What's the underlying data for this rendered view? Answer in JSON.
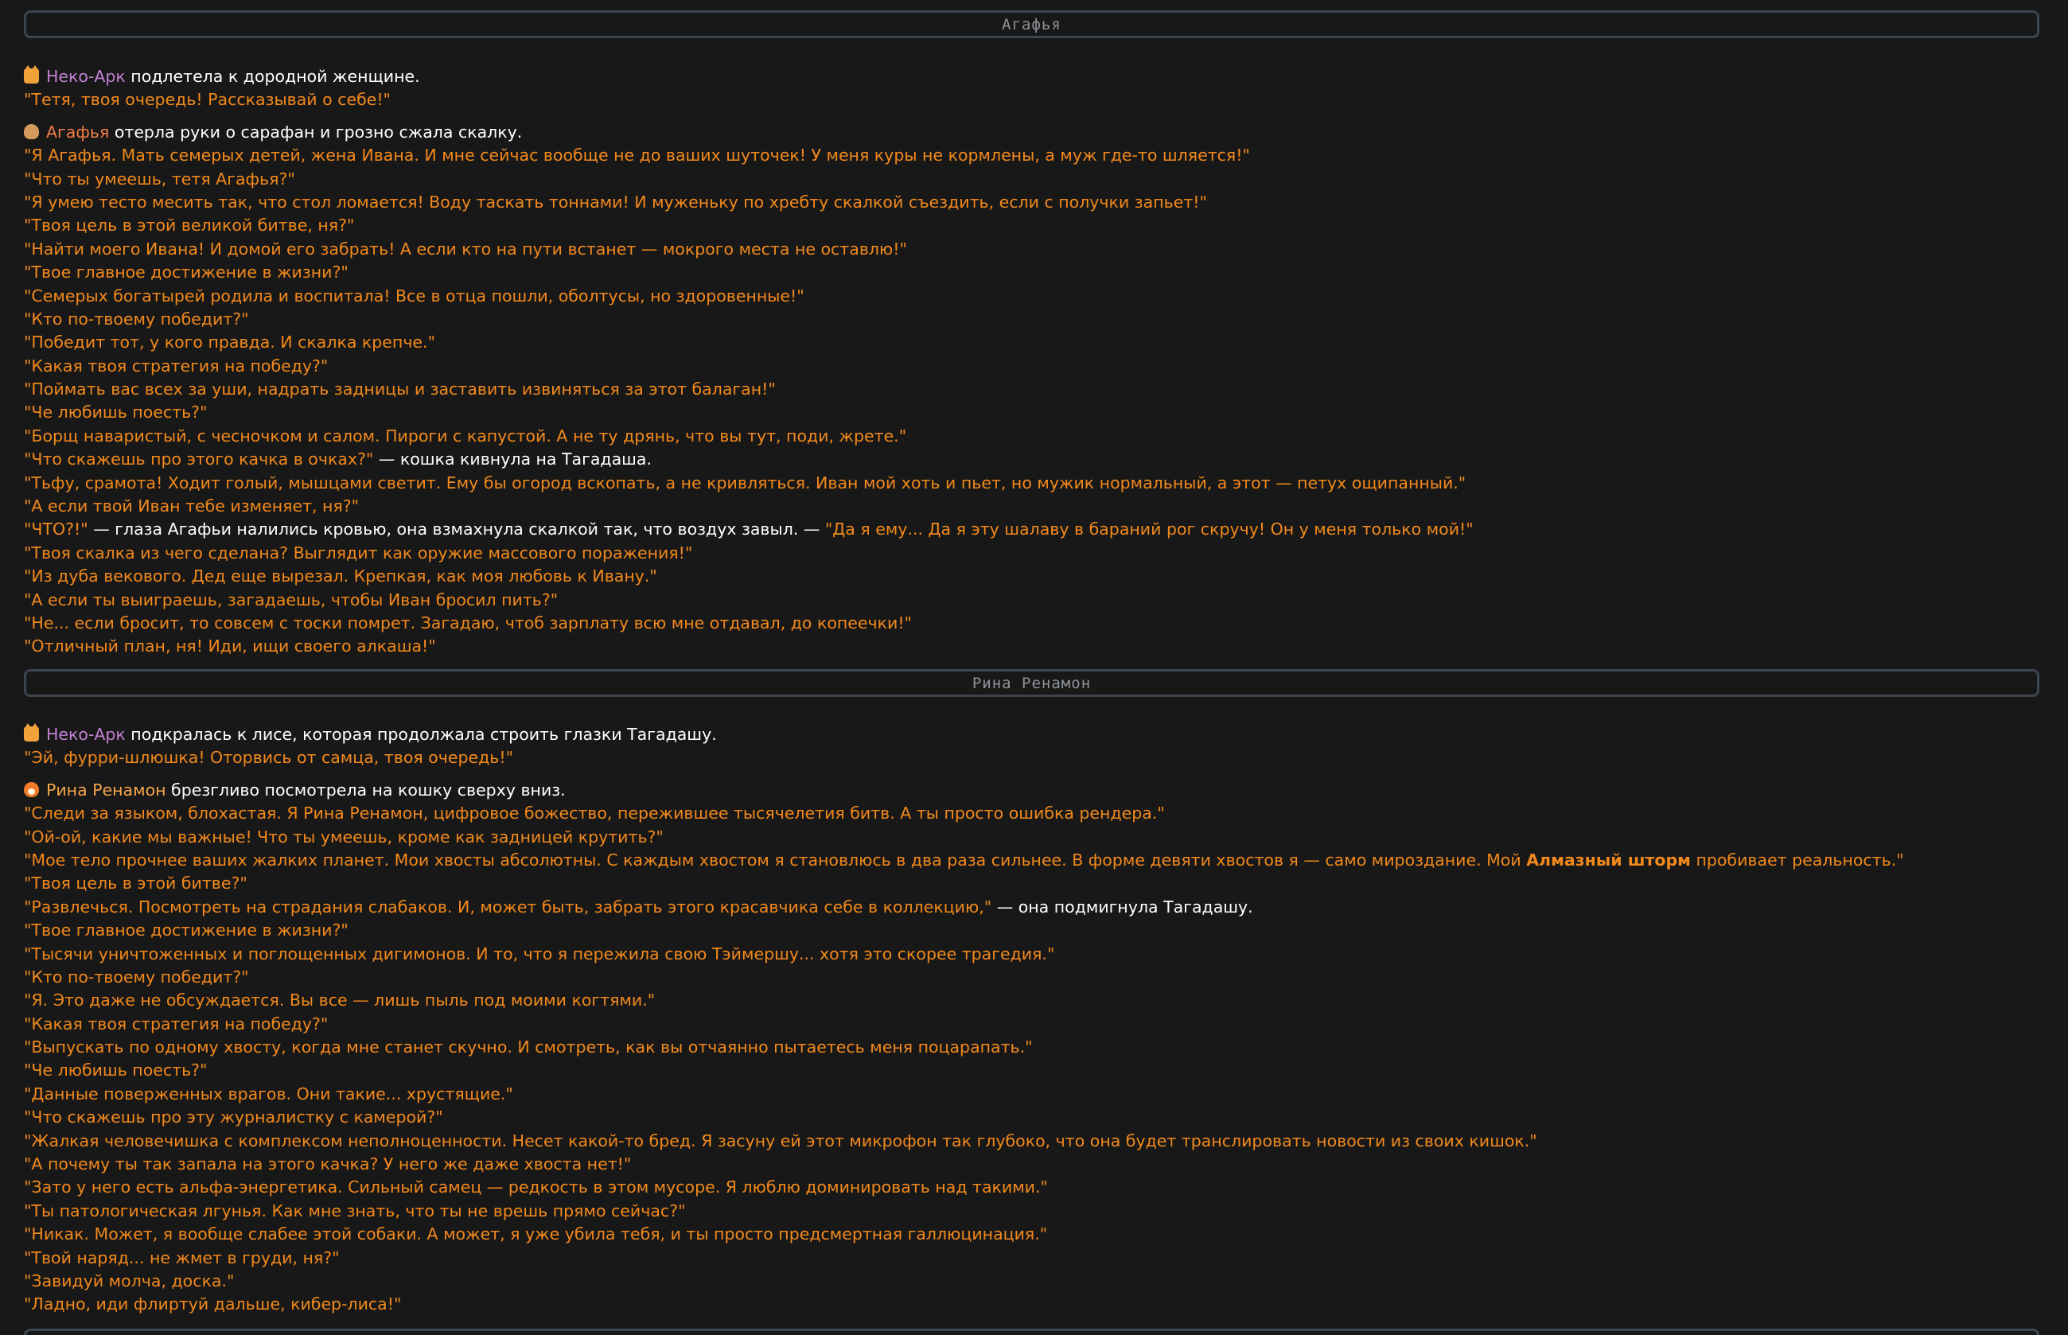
{
  "sections": [
    {
      "header": "Агафья",
      "intro": {
        "neko_name": "Неко-Арк",
        "neko_action": " подлетела к дородной женщине.",
        "neko_quote": "\"Тетя, твоя очередь! Рассказывай о себе!\"",
        "char_name": "Агафья",
        "char_action": " отерла руки о сарафан и грозно сжала скалку."
      },
      "lines": [
        "\"Я Агафья. Мать семерых детей, жена Ивана. И мне сейчас вообще не до ваших шуточек! У меня куры не кормлены, а муж где-то шляется!\"",
        "\"Что ты умеешь, тетя Агафья?\"",
        "\"Я умею тесто месить так, что стол ломается! Воду таскать тоннами! И муженьку по хребту скалкой съездить, если с получки запьет!\"",
        "\"Твоя цель в этой великой битве, ня?\"",
        "\"Найти моего Ивана! И домой его забрать! А если кто на пути встанет — мокрого места не оставлю!\"",
        "\"Твое главное достижение в жизни?\"",
        "\"Семерых богатырей родила и воспитала! Все в отца пошли, оболтусы, но здоровенные!\"",
        "\"Кто по-твоему победит?\"",
        "\"Победит тот, у кого правда. И скалка крепче.\"",
        "\"Какая твоя стратегия на победу?\"",
        "\"Поймать вас всех за уши, надрать задницы и заставить извиняться за этот балаган!\"",
        "\"Че любишь поесть?\"",
        "\"Борщ наваристый, с чесночком и салом. Пироги с капустой. А не ту дрянь, что вы тут, поди, жрете.\""
      ],
      "mixed1_quote": "\"Что скажешь про этого качка в очках?\"",
      "mixed1_text": " — кошка кивнула на Тагадаша.",
      "lines2": [
        "\"Тьфу, срамота! Ходит голый, мышцами светит. Ему бы огород вскопать, а не кривляться. Иван мой хоть и пьет, но мужик нормальный, а этот — петух ощипанный.\"",
        "\"А если твой Иван тебе изменяет, ня?\""
      ],
      "mixed2_quote1": "\"ЧТО?!\"",
      "mixed2_text": " — глаза Агафьи налились кровью, она взмахнула скалкой так, что воздух завыл. — ",
      "mixed2_quote2": "\"Да я ему... Да я эту шалаву в бараний рог скручу! Он у меня только мой!\"",
      "lines3": [
        "\"Твоя скалка из чего сделана? Выглядит как оружие массового поражения!\"",
        "\"Из дуба векового. Дед еще вырезал. Крепкая, как моя любовь к Ивану.\"",
        "\"А если ты выиграешь, загадаешь, чтобы Иван бросил пить?\"",
        "\"Не... если бросит, то совсем с тоски помрет. Загадаю, чтоб зарплату всю мне отдавал, до копеечки!\"",
        "\"Отличный план, ня! Иди, ищи своего алкаша!\""
      ]
    },
    {
      "header": "Рина Ренамон",
      "intro": {
        "neko_name": "Неко-Арк",
        "neko_action": " подкралась к лисе, которая продолжала строить глазки Тагадашу.",
        "neko_quote": "\"Эй, фурри-шлюшка! Оторвись от самца, твоя очередь!\"",
        "char_name": "Рина Ренамон",
        "char_action": " брезгливо посмотрела на кошку сверху вниз."
      },
      "lines": [
        "\"Следи за языком, блохастая. Я Рина Ренамон, цифровое божество, пережившее тысячелетия битв. А ты просто ошибка рендера.\"",
        "\"Ой-ой, какие мы важные! Что ты умеешь, кроме как задницей крутить?\""
      ],
      "body_quote_pre": "\"Мое тело прочнее ваших жалких планет. Мои хвосты абсолютны. С каждым хвостом я становлюсь в два раза сильнее. В форме девяти хвостов я — само мироздание. Мой ",
      "body_quote_bold": "Алмазный шторм",
      "body_quote_post": " пробивает реальность.\"",
      "lines_a": [
        "\"Твоя цель в этой битве?\""
      ],
      "mixed_quote": "\"Развлечься. Посмотреть на страдания слабаков. И, может быть, забрать этого красавчика себе в коллекцию,\"",
      "mixed_text": " — она подмигнула Тагадашу.",
      "lines_b": [
        "\"Твое главное достижение в жизни?\"",
        "\"Тысячи уничтоженных и поглощенных дигимонов. И то, что я пережила свою Тэймершу... хотя это скорее трагедия.\"",
        "\"Кто по-твоему победит?\"",
        "\"Я. Это даже не обсуждается. Вы все — лишь пыль под моими когтями.\"",
        "\"Какая твоя стратегия на победу?\"",
        "\"Выпускать по одному хвосту, когда мне станет скучно. И смотреть, как вы отчаянно пытаетесь меня поцарапать.\"",
        "\"Че любишь поесть?\"",
        "\"Данные поверженных врагов. Они такие... хрустящие.\"",
        "\"Что скажешь про эту журналистку с камерой?\"",
        "\"Жалкая человечишка с комплексом неполноценности. Несет какой-то бред. Я засуну ей этот микрофон так глубоко, что она будет транслировать новости из своих кишок.\"",
        "\"А почему ты так запала на этого качка? У него же даже хвоста нет!\"",
        "\"Зато у него есть альфа-энергетика. Сильный самец — редкость в этом мусоре. Я люблю доминировать над такими.\"",
        "\"Ты патологическая лгунья. Как мне знать, что ты не врешь прямо сейчас?\"",
        "\"Никак. Может, я вообще слабее этой собаки. А может, я уже убила тебя, и ты просто предсмертная галлюцинация.\"",
        "\"Твой наряд... не жмет в груди, ня?\"",
        "\"Завидуй молча, доска.\"",
        "\"Ладно, иди флиртуй дальше, кибер-лиса!\""
      ]
    }
  ],
  "icons": {
    "neko": "cat-face-icon",
    "agafya": "bread-icon",
    "rina": "fox-face-icon"
  },
  "colors": {
    "background": "#181818",
    "quote": "#f2891c",
    "narration": "#ffffff",
    "neko_name": "#c180d2",
    "agafya_name": "#f07e48",
    "rina_name": "#f5a64a",
    "header_border": "#3c4550",
    "header_text": "#8f9499"
  }
}
